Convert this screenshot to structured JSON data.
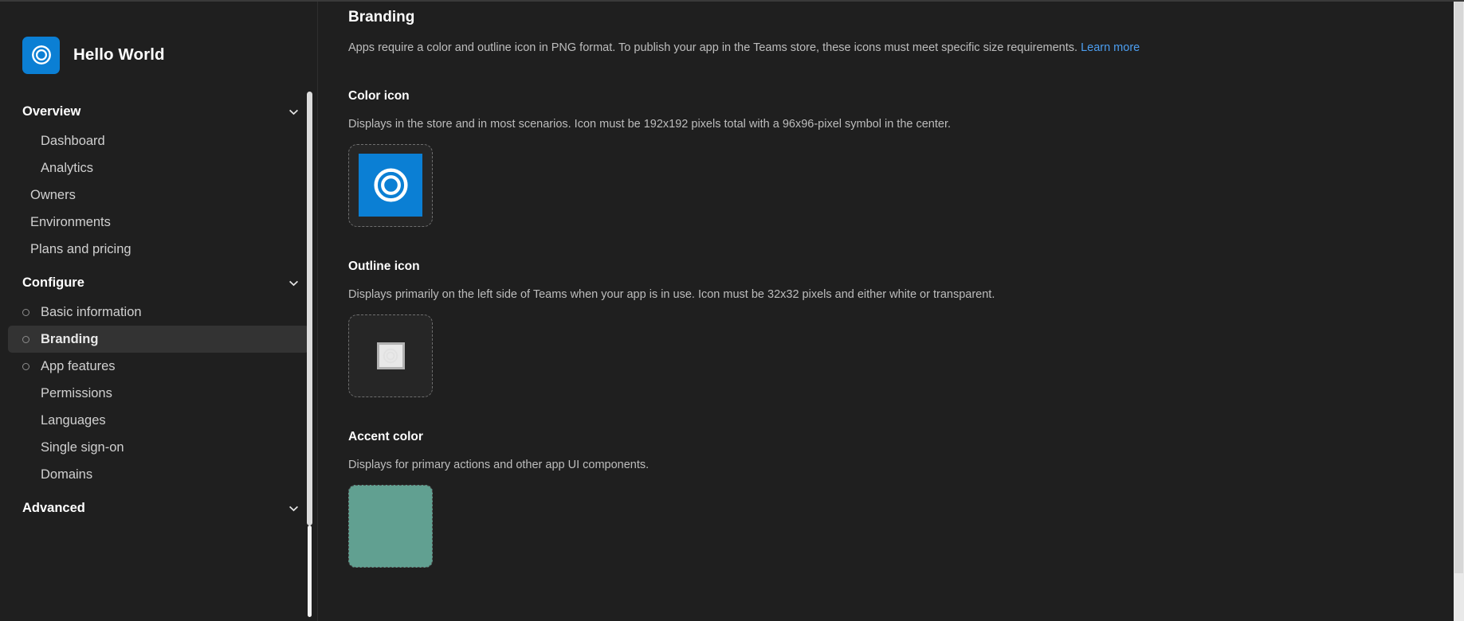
{
  "app": {
    "name": "Hello World",
    "logo_icon": "swirl-logo-icon",
    "logo_background": "#0b7fd4"
  },
  "sidebar": {
    "groups": [
      {
        "label": "Overview",
        "expanded": true,
        "chevron_icon": "chevron-down-icon",
        "items": [
          {
            "label": "Dashboard",
            "bullet": false,
            "selected": false
          },
          {
            "label": "Analytics",
            "bullet": false,
            "selected": false
          }
        ]
      }
    ],
    "standalone": [
      {
        "label": "Owners",
        "bullet": false,
        "selected": false
      },
      {
        "label": "Environments",
        "bullet": false,
        "selected": false
      },
      {
        "label": "Plans and pricing",
        "bullet": false,
        "selected": false
      }
    ],
    "configure": {
      "label": "Configure",
      "expanded": true,
      "chevron_icon": "chevron-down-icon",
      "items": [
        {
          "label": "Basic information",
          "bullet": true,
          "selected": false
        },
        {
          "label": "Branding",
          "bullet": true,
          "selected": true
        },
        {
          "label": "App features",
          "bullet": true,
          "selected": false
        },
        {
          "label": "Permissions",
          "bullet": false,
          "selected": false
        },
        {
          "label": "Languages",
          "bullet": false,
          "selected": false
        },
        {
          "label": "Single sign-on",
          "bullet": false,
          "selected": false
        },
        {
          "label": "Domains",
          "bullet": false,
          "selected": false
        }
      ]
    },
    "advanced": {
      "label": "Advanced",
      "expanded": false,
      "chevron_icon": "chevron-down-icon"
    },
    "selected_item": "Branding"
  },
  "main": {
    "title": "Branding",
    "description": "Apps require a color and outline icon in PNG format. To publish your app in the Teams store, these icons must meet specific size requirements.",
    "learn_more_label": "Learn more",
    "learn_more_color": "#4c9ef0",
    "sections": [
      {
        "title": "Color icon",
        "description": "Displays in the store and in most scenarios. Icon must be 192x192 pixels total with a 96x96-pixel symbol in the center.",
        "preview_type": "color-icon",
        "preview_icon": "swirl-logo-icon",
        "preview_background": "#0b7fd4"
      },
      {
        "title": "Outline icon",
        "description": "Displays primarily on the left side of Teams when your app is in use. Icon must be 32x32 pixels and either white or transparent.",
        "preview_type": "outline-icon",
        "preview_icon": "swirl-logo-outline-icon",
        "preview_background": "#f7f7f7"
      },
      {
        "title": "Accent color",
        "description": "Displays for primary actions and other app UI components.",
        "preview_type": "accent-color",
        "preview_background": "#61a091"
      }
    ]
  },
  "theme": {
    "background": "#1f1f1f",
    "panel_background": "#262626",
    "selected_row": "#333333",
    "text_primary": "#ffffff",
    "text_secondary": "#bdbdbd",
    "brand_blue": "#0b7fd4",
    "accent_color": "#61a091"
  }
}
